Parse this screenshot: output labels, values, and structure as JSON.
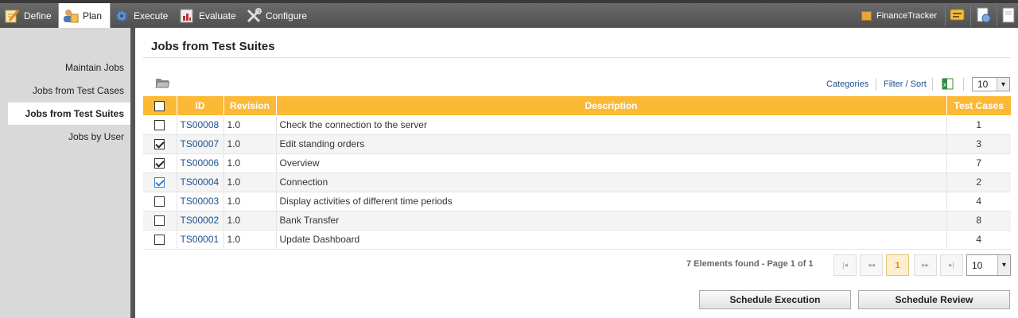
{
  "nav": {
    "define": "Define",
    "plan": "Plan",
    "execute": "Execute",
    "evaluate": "Evaluate",
    "configure": "Configure",
    "project": "FinanceTracker"
  },
  "sidebar": {
    "items": [
      "Maintain Jobs",
      "Jobs from Test Cases",
      "Jobs from Test Suites",
      "Jobs by User"
    ],
    "active": "Jobs from Test Suites"
  },
  "page": {
    "title": "Jobs from Test Suites",
    "categories": "Categories",
    "filter_sort": "Filter / Sort",
    "top_page_size": "10"
  },
  "table": {
    "headers": [
      "ID",
      "Revision",
      "Description",
      "Test Cases"
    ],
    "rows": [
      {
        "id": "TS00008",
        "rev": "1.0",
        "desc": "Check the connection to the server",
        "cases": "1",
        "checked": false
      },
      {
        "id": "TS00007",
        "rev": "1.0",
        "desc": "Edit standing orders",
        "cases": "3",
        "checked": true
      },
      {
        "id": "TS00006",
        "rev": "1.0",
        "desc": "Overview",
        "cases": "7",
        "checked": true
      },
      {
        "id": "TS00004",
        "rev": "1.0",
        "desc": "Connection",
        "cases": "2",
        "checked": true
      },
      {
        "id": "TS00003",
        "rev": "1.0",
        "desc": "Display activities of different time periods",
        "cases": "4",
        "checked": false
      },
      {
        "id": "TS00002",
        "rev": "1.0",
        "desc": "Bank Transfer",
        "cases": "8",
        "checked": false
      },
      {
        "id": "TS00001",
        "rev": "1.0",
        "desc": "Update Dashboard",
        "cases": "4",
        "checked": false
      }
    ]
  },
  "pager": {
    "found": "7 Elements found - Page 1 of 1",
    "first": "|◂",
    "prev": "◂◂",
    "current": "1",
    "next": "▸▸",
    "last": "▸|",
    "page_size": "10"
  },
  "buttons": {
    "schedule_execution": "Schedule Execution",
    "schedule_review": "Schedule Review"
  },
  "colors": {
    "header": "#fbb936",
    "link": "#1f4f8f"
  }
}
